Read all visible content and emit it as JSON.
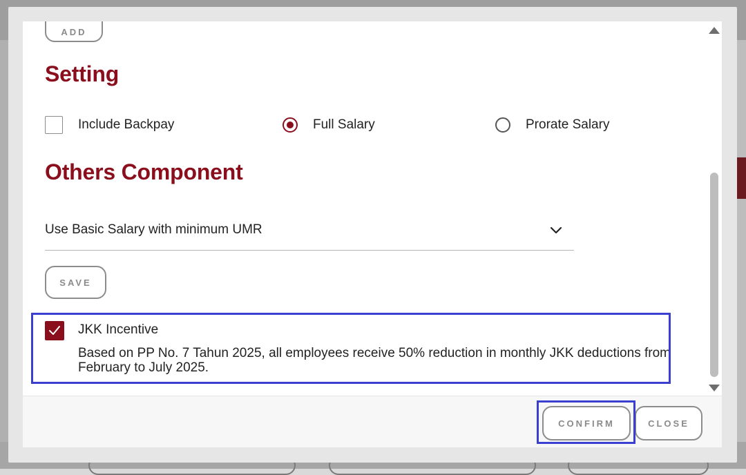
{
  "buttons": {
    "add": "ADD",
    "save": "SAVE",
    "confirm": "CONFIRM",
    "close": "CLOSE"
  },
  "setting": {
    "title": "Setting",
    "include_backpay": {
      "label": "Include Backpay",
      "checked": false
    },
    "salary_mode": {
      "options": [
        "Full Salary",
        "Prorate Salary"
      ],
      "selected": "Full Salary"
    }
  },
  "others_component": {
    "title": "Others Component",
    "select_value": "Use Basic Salary with minimum UMR"
  },
  "jkk_incentive": {
    "label": "JKK Incentive",
    "checked": true,
    "description": "Based on PP No. 7 Tahun 2025, all employees receive 50% reduction in monthly JKK deductions from February to July 2025."
  },
  "icons": {
    "dropdown": "chevron-down-icon",
    "check": "check-icon",
    "scroll_up": "scroll-up-arrow-icon",
    "scroll_down": "scroll-down-arrow-icon"
  },
  "colors": {
    "brand": "#8b0e1d",
    "highlight": "#3b3fcf"
  }
}
